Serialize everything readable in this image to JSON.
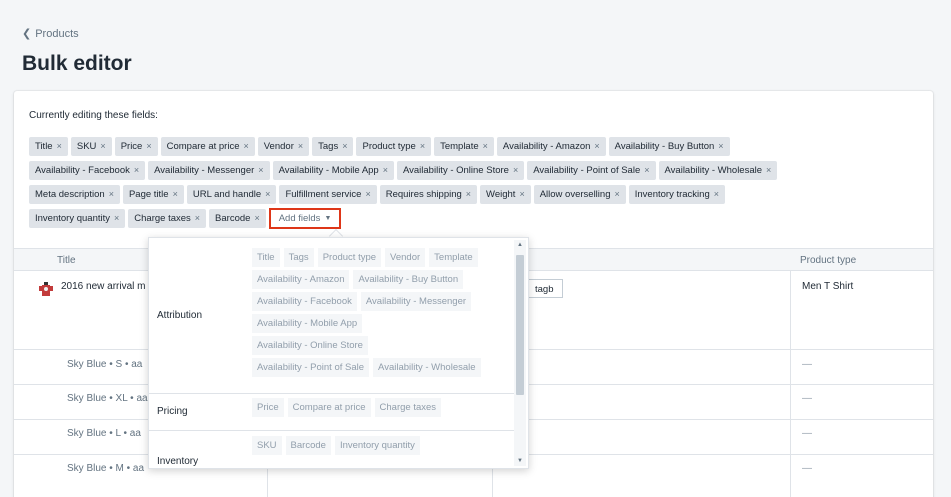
{
  "breadcrumb": {
    "label": "Products"
  },
  "page": {
    "title": "Bulk editor"
  },
  "editing": {
    "label": "Currently editing these fields:",
    "rows": [
      [
        "Title",
        "SKU",
        "Price",
        "Compare at price",
        "Vendor",
        "Tags",
        "Product type",
        "Template",
        "Availability - Amazon",
        "Availability - Buy Button"
      ],
      [
        "Availability - Facebook",
        "Availability - Messenger",
        "Availability - Mobile App",
        "Availability - Online Store",
        "Availability - Point of Sale",
        "Availability - Wholesale"
      ],
      [
        "Meta description",
        "Page title",
        "URL and handle",
        "Fulfillment service",
        "Requires shipping",
        "Weight",
        "Allow overselling",
        "Inventory tracking"
      ],
      [
        "Inventory quantity",
        "Charge taxes",
        "Barcode"
      ]
    ],
    "remove_glyph": "×",
    "add_fields_label": "Add fields",
    "add_fields_caret": "▼"
  },
  "table": {
    "columns": {
      "title": "Title",
      "product_type": "Product type"
    },
    "product": {
      "title": "2016 new arrival m",
      "tag": "tagb",
      "product_type": "Men T Shirt"
    },
    "variants": [
      {
        "title": "Sky Blue • S • aa",
        "product_type": "—"
      },
      {
        "title": "Sky Blue • XL • aa",
        "product_type": "—"
      },
      {
        "title": "Sky Blue • L • aa",
        "product_type": "—"
      },
      {
        "title": "Sky Blue • M • aa",
        "product_type": "—"
      }
    ]
  },
  "dropdown": {
    "sections": [
      {
        "label": "Attribution",
        "rows": [
          [
            "Title",
            "Tags",
            "Product type",
            "Vendor",
            "Template"
          ],
          [
            "Availability - Amazon",
            "Availability - Buy Button"
          ],
          [
            "Availability - Facebook",
            "Availability - Messenger"
          ],
          [
            "Availability - Mobile App"
          ],
          [
            "Availability - Online Store"
          ],
          [
            "Availability - Point of Sale",
            "Availability - Wholesale"
          ]
        ]
      },
      {
        "label": "Pricing",
        "rows": [
          [
            "Price",
            "Compare at price",
            "Charge taxes"
          ]
        ]
      },
      {
        "label": "Inventory",
        "rows": [
          [
            "SKU",
            "Barcode",
            "Inventory quantity"
          ]
        ]
      }
    ]
  },
  "colors": {
    "accent_red": "#de3618",
    "tag_bg": "#dfe3e8",
    "page_bg": "#f4f6f8"
  }
}
